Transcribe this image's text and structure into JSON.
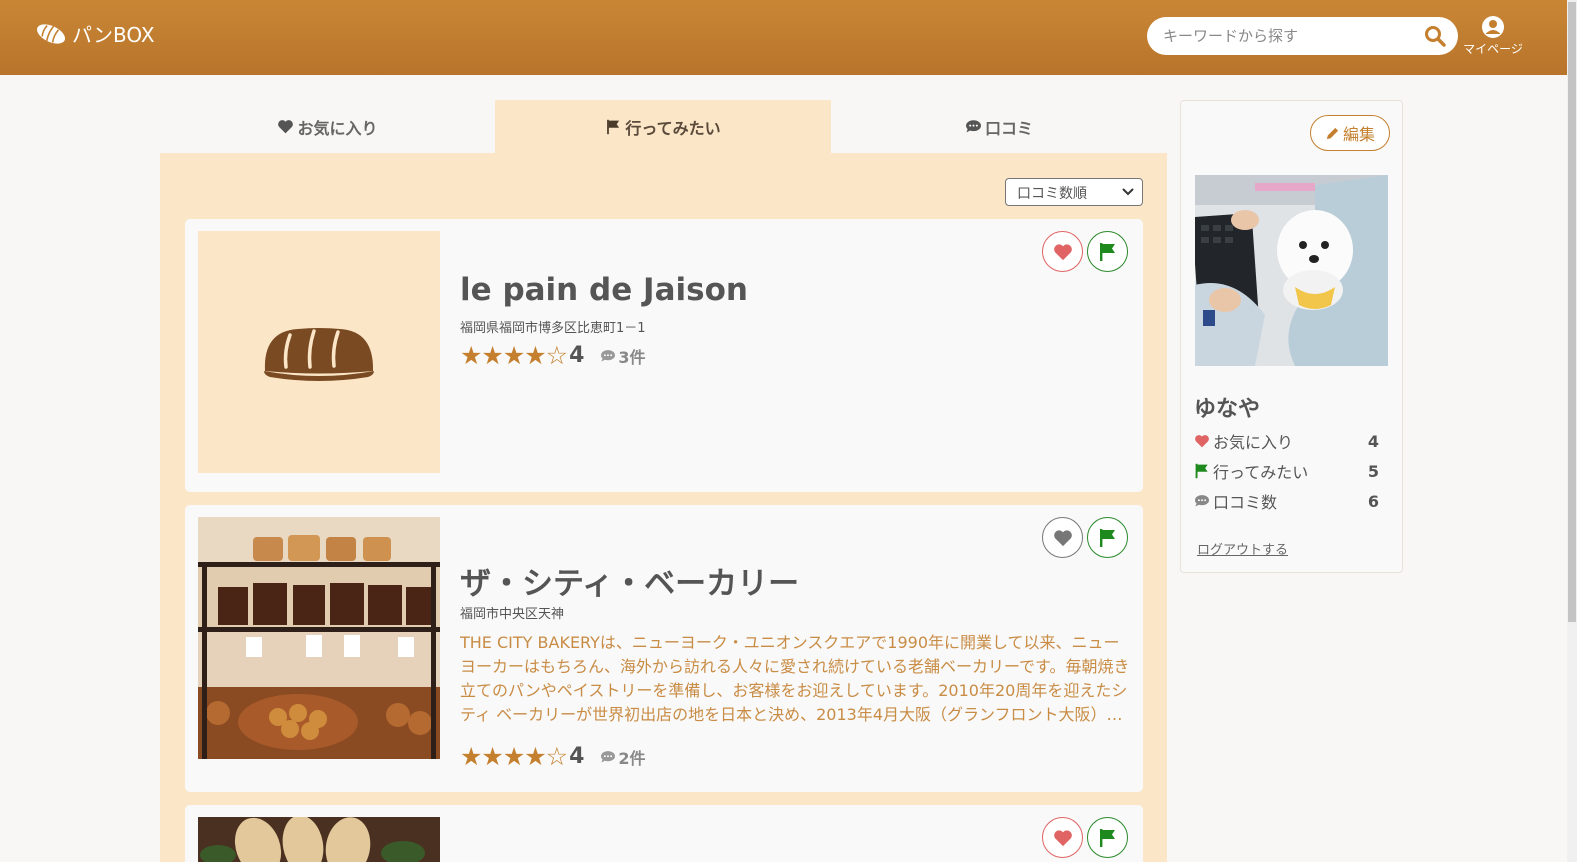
{
  "header": {
    "logo_text": "パンBOX",
    "search_placeholder": "キーワードから探す",
    "mypage_label": "マイページ",
    "brand_color": "#c4802e"
  },
  "tabs": [
    {
      "label": "お気に入り",
      "icon": "heart-icon",
      "active": false
    },
    {
      "label": "行ってみたい",
      "icon": "flag-icon",
      "active": true
    },
    {
      "label": "口コミ",
      "icon": "comment-icon",
      "active": false
    }
  ],
  "sort": {
    "selected": "口コミ数順"
  },
  "shops": [
    {
      "name": "le pain de Jaison",
      "address": "福岡県福岡市博多区比恵町1－1",
      "description": "",
      "stars_filled": 4,
      "stars_total": 5,
      "score": "4",
      "review_count": "3件",
      "favorited": true,
      "want_to_go": true,
      "image": "bread-placeholder-icon"
    },
    {
      "name": "ザ・シティ・ベーカリー",
      "address": "福岡市中央区天神",
      "description": "THE CITY BAKERYは、ニューヨーク・ユニオンスクエアで1990年に開業して以来、ニューヨーカーはもちろん、海外から訪れる人々に愛され続けている老舗ベーカリーです。毎朝焼き立てのパンやペイストリーを準備し、お客様をお迎えしています。2010年20周年を迎えたシティ ベーカリーが世界初出店の地を日本と決め、2013年4月大阪（グランフロント大阪）…",
      "stars_filled": 4,
      "stars_total": 5,
      "score": "4",
      "review_count": "2件",
      "favorited": false,
      "want_to_go": true,
      "image": "bakery-shelves-photo"
    },
    {
      "name": "",
      "address": "",
      "description": "",
      "favorited": true,
      "want_to_go": true,
      "image": "bread-loaves-photo"
    }
  ],
  "sidebar": {
    "edit_label": "編集",
    "username": "ゆなや",
    "avatar": "dog-on-desk-photo",
    "stats": [
      {
        "label": "お気に入り",
        "icon": "heart-icon",
        "count": "4"
      },
      {
        "label": "行ってみたい",
        "icon": "flag-icon",
        "count": "5"
      },
      {
        "label": "口コミ数",
        "icon": "comment-icon",
        "count": "6"
      }
    ],
    "logout_label": "ログアウトする"
  }
}
